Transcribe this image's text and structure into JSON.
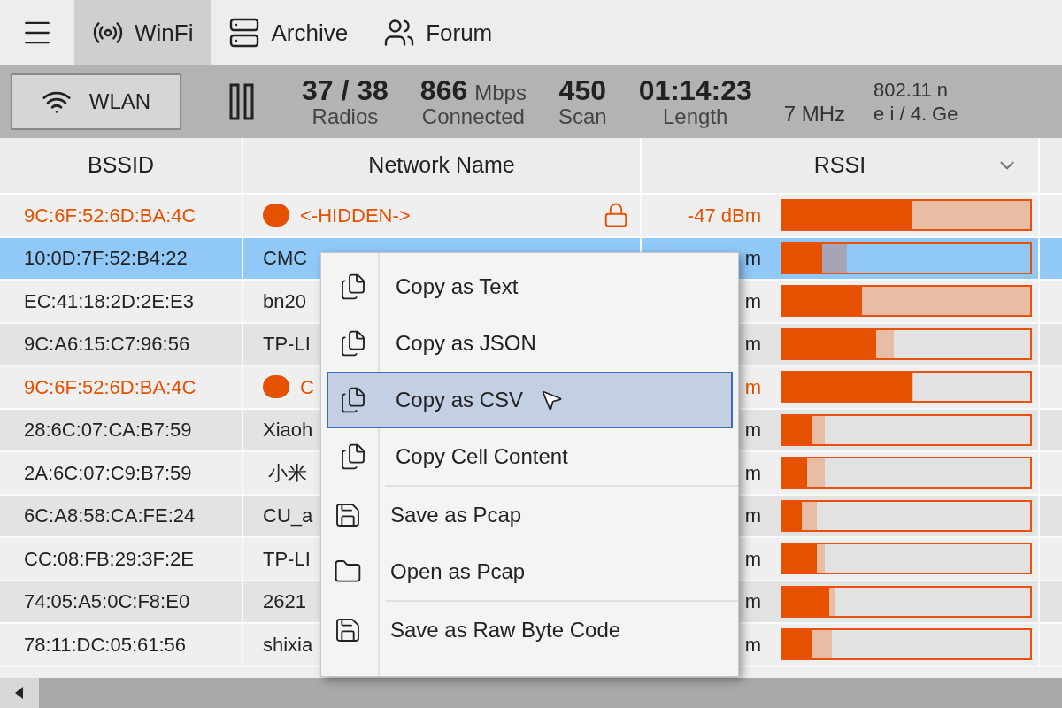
{
  "nav": {
    "tabs": [
      {
        "label": "WinFi",
        "kind": "radio",
        "selected": true
      },
      {
        "label": "Archive",
        "kind": "server",
        "selected": false
      },
      {
        "label": "Forum",
        "kind": "users",
        "selected": false
      }
    ]
  },
  "toolbar": {
    "device_button": "WLAN",
    "paused": true,
    "stats": [
      {
        "value": "37 / 38",
        "label": "Radios"
      },
      {
        "value": "866",
        "unit": "Mbps",
        "label": "Connected"
      },
      {
        "value": "450",
        "label": "Scan"
      },
      {
        "value": "01:14:23",
        "label": "Length"
      }
    ],
    "bandwidth": "7 MHz",
    "standard_line_1": "802.11 n",
    "standard_line_2": "e i / 4. Ge"
  },
  "table": {
    "columns": [
      "BSSID",
      "Network Name",
      "RSSI"
    ],
    "rows": [
      {
        "kind": "alert",
        "selected": false,
        "bssid": "9C:6F:52:6D:BA:4C",
        "name": "<-HIDDEN->",
        "locked": true,
        "rssi": "-47 dBm",
        "bar": {
          "level": 0.52,
          "peak": {
            "level": 1.0
          }
        }
      },
      {
        "kind": "normal",
        "selected": true,
        "bssid": "10:0D:7F:52:B4:22",
        "name": "CMC",
        "rssi": "m",
        "bar": {
          "level": 0.16,
          "peak": {
            "level": 0.26
          }
        }
      },
      {
        "kind": "normal",
        "selected": false,
        "bssid": "EC:41:18:2D:2E:E3",
        "name": "bn20",
        "rssi": "m",
        "bar": {
          "level": 0.32,
          "peak": {
            "level": 1.0
          }
        }
      },
      {
        "kind": "normal",
        "selected": false,
        "bssid": "9C:A6:15:C7:96:56",
        "name": "TP-LI",
        "rssi": "m",
        "bar": {
          "level": 0.38,
          "peak": {
            "level": 0.45
          }
        }
      },
      {
        "kind": "alert",
        "selected": false,
        "bssid": "9C:6F:52:6D:BA:4C",
        "name": "C",
        "rssi": "m",
        "bar": {
          "level": 0.52,
          "peak": {
            "level": 0.53
          }
        }
      },
      {
        "kind": "normal",
        "selected": false,
        "bssid": "28:6C:07:CA:B7:59",
        "name": "Xiaoh",
        "rssi": "m",
        "bar": {
          "level": 0.12,
          "peak": {
            "level": 0.17
          }
        }
      },
      {
        "kind": "normal",
        "selected": false,
        "bssid": "2A:6C:07:C9:B7:59",
        "name": " 小米",
        "rssi": "m",
        "bar": {
          "level": 0.1,
          "peak": {
            "level": 0.17
          }
        }
      },
      {
        "kind": "normal",
        "selected": false,
        "bssid": "6C:A8:58:CA:FE:24",
        "name": "CU_a",
        "rssi": "m",
        "bar": {
          "level": 0.08,
          "peak": {
            "level": 0.14
          }
        }
      },
      {
        "kind": "normal",
        "selected": false,
        "bssid": "CC:08:FB:29:3F:2E",
        "name": "TP-LI",
        "rssi": "m",
        "bar": {
          "level": 0.14,
          "peak": {
            "level": 0.17
          }
        }
      },
      {
        "kind": "normal",
        "selected": false,
        "bssid": "74:05:A5:0C:F8:E0",
        "name": "2621",
        "rssi": "m",
        "bar": {
          "level": 0.19,
          "peak": {
            "level": 0.21
          }
        }
      },
      {
        "kind": "normal",
        "selected": false,
        "bssid": "78:11:DC:05:61:56",
        "name": "shixia",
        "rssi": "m",
        "bar": {
          "level": 0.12,
          "peak": {
            "level": 0.2
          }
        }
      }
    ]
  },
  "context_menu": {
    "groups": [
      [
        {
          "kind": "copy",
          "label": "Copy as Text",
          "selected": false
        },
        {
          "kind": "copy",
          "label": "Copy as JSON",
          "selected": false
        },
        {
          "kind": "copy",
          "label": "Copy as CSV",
          "selected": true
        },
        {
          "kind": "copy",
          "label": "Copy Cell Content",
          "selected": false
        }
      ],
      [
        {
          "kind": "save",
          "label": "Save as Pcap",
          "selected": false
        },
        {
          "kind": "open",
          "label": "Open as Pcap",
          "selected": false
        }
      ],
      [
        {
          "kind": "save",
          "label": "Save as Raw Byte Code",
          "selected": false
        }
      ]
    ]
  }
}
